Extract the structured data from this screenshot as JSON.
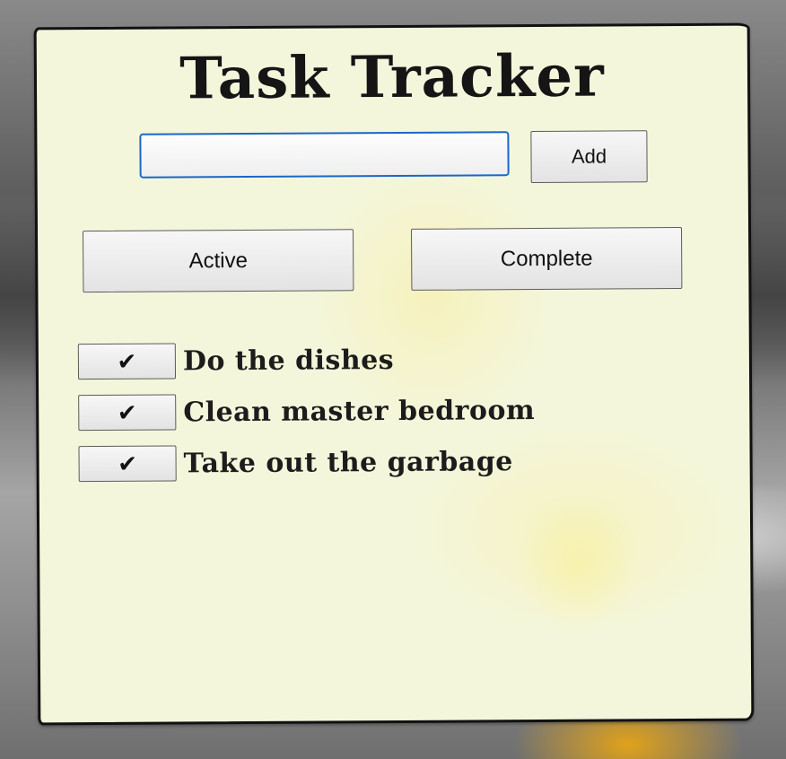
{
  "app": {
    "title": "Task Tracker"
  },
  "new_task": {
    "value": "",
    "placeholder": "",
    "add_label": "Add"
  },
  "filters": {
    "active_label": "Active",
    "complete_label": "Complete"
  },
  "tasks": [
    {
      "check_glyph": "✔",
      "label": "Do the dishes"
    },
    {
      "check_glyph": "✔",
      "label": "Clean master bedroom"
    },
    {
      "check_glyph": "✔",
      "label": "Take out the garbage"
    }
  ],
  "colors": {
    "card_background": "#f4f6dc",
    "input_focus_border": "#1a66c9",
    "text": "#151515"
  }
}
